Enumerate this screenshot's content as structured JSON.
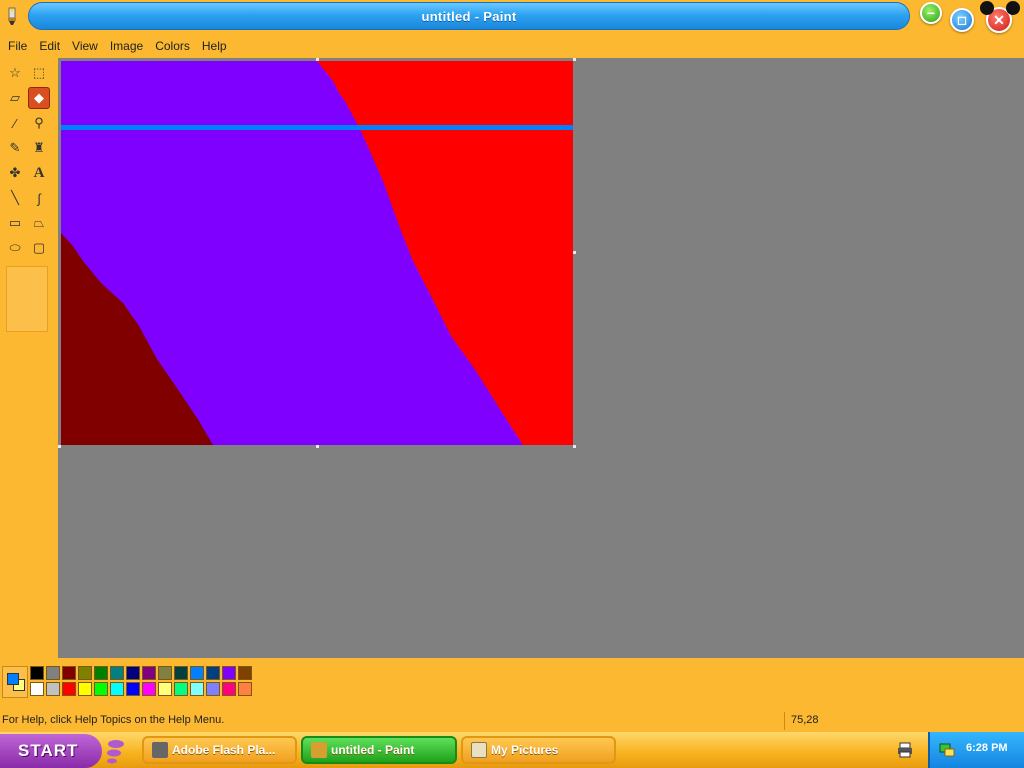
{
  "window": {
    "title": "untitled - Paint",
    "app_icon": "paint-brush-icon",
    "controls": {
      "minimize": "minimize-icon",
      "maximize": "maximize-icon",
      "close": "close-icon"
    }
  },
  "menu": {
    "items": [
      "File",
      "Edit",
      "View",
      "Image",
      "Colors",
      "Help"
    ]
  },
  "toolbox": {
    "tools": [
      {
        "name": "free-form-select",
        "icon": "free-form-select-icon",
        "glyph": "☆"
      },
      {
        "name": "select",
        "icon": "rectangle-select-icon",
        "glyph": "⬚"
      },
      {
        "name": "eraser",
        "icon": "eraser-icon",
        "glyph": "▱"
      },
      {
        "name": "fill",
        "icon": "fill-bucket-icon",
        "glyph": "◆",
        "active": true
      },
      {
        "name": "pick-color",
        "icon": "eyedropper-icon",
        "glyph": "⁄"
      },
      {
        "name": "magnifier",
        "icon": "magnifier-icon",
        "glyph": "⚲"
      },
      {
        "name": "pencil",
        "icon": "pencil-icon",
        "glyph": "✎"
      },
      {
        "name": "brush",
        "icon": "brush-icon",
        "glyph": "♜"
      },
      {
        "name": "airbrush",
        "icon": "airbrush-icon",
        "glyph": "✤"
      },
      {
        "name": "text",
        "icon": "text-icon",
        "glyph": "A"
      },
      {
        "name": "line",
        "icon": "line-icon",
        "glyph": "╲"
      },
      {
        "name": "curve",
        "icon": "curve-icon",
        "glyph": "∫"
      },
      {
        "name": "rectangle",
        "icon": "rectangle-icon",
        "glyph": "▭"
      },
      {
        "name": "polygon",
        "icon": "polygon-icon",
        "glyph": "⏢"
      },
      {
        "name": "ellipse",
        "icon": "ellipse-icon",
        "glyph": "⬭"
      },
      {
        "name": "rounded-rectangle",
        "icon": "rounded-rectangle-icon",
        "glyph": "▢"
      }
    ]
  },
  "canvas": {
    "colors": {
      "purple": "#8000ff",
      "red": "#ff0000",
      "maroon": "#800000",
      "blue_line": "#0080ff"
    }
  },
  "palette": {
    "foreground": "#0080ff",
    "background": "#ffff80",
    "top_row": [
      "#000000",
      "#808080",
      "#800000",
      "#808000",
      "#008000",
      "#008080",
      "#000080",
      "#800080",
      "#808040",
      "#004040",
      "#0080ff",
      "#004080",
      "#8000ff",
      "#804000"
    ],
    "bottom_row": [
      "#ffffff",
      "#c0c0c0",
      "#ff0000",
      "#ffff00",
      "#00ff00",
      "#00ffff",
      "#0000ff",
      "#ff00ff",
      "#ffff80",
      "#00ff80",
      "#80ffff",
      "#8080ff",
      "#ff0080",
      "#ff8040"
    ]
  },
  "status": {
    "help_text": "For Help, click Help Topics on the Help Menu.",
    "coordinates": "75,28"
  },
  "taskbar": {
    "start_label": "START",
    "buttons": [
      {
        "label": "Adobe Flash Pla...",
        "icon": "flash-player-icon",
        "active": false
      },
      {
        "label": "untitled - Paint",
        "icon": "paint-icon",
        "active": true
      },
      {
        "label": "My Pictures",
        "icon": "folder-icon",
        "active": false
      }
    ],
    "clock": "6:28 PM",
    "tray_icon": "network-icon",
    "sys_icon": "printer-icon"
  }
}
